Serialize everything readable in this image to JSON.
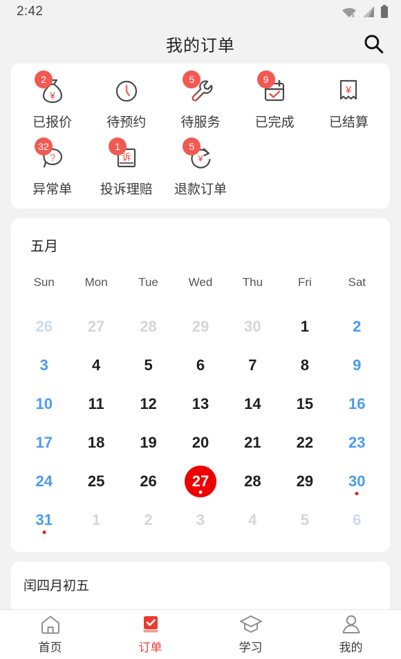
{
  "statusbar": {
    "time": "2:42",
    "icons": [
      "wifi-off-icon",
      "cellular-signal-icon",
      "battery-icon"
    ]
  },
  "header": {
    "title": "我的订单",
    "search_icon": "search-icon"
  },
  "order_status": {
    "row1": [
      {
        "icon": "money-bag-icon",
        "label": "已报价",
        "badge": "2"
      },
      {
        "icon": "clock-icon",
        "label": "待预约",
        "badge": ""
      },
      {
        "icon": "wrench-icon",
        "label": "待服务",
        "badge": "5"
      },
      {
        "icon": "calendar-check-icon",
        "label": "已完成",
        "badge": "9"
      },
      {
        "icon": "receipt-yuan-icon",
        "label": "已结算",
        "badge": ""
      }
    ],
    "row2": [
      {
        "icon": "question-bubble-icon",
        "label": "异常单",
        "badge": "32"
      },
      {
        "icon": "complaint-book-icon",
        "label": "投诉理赔",
        "badge": "1"
      },
      {
        "icon": "refund-yuan-icon",
        "label": "退款订单",
        "badge": "5"
      }
    ]
  },
  "calendar": {
    "month_label": "五月",
    "weekdays": [
      "Sun",
      "Mon",
      "Tue",
      "Wed",
      "Thu",
      "Fri",
      "Sat"
    ],
    "weeks": [
      [
        {
          "n": "26",
          "muted": true,
          "weekend": true
        },
        {
          "n": "27",
          "muted": true
        },
        {
          "n": "28",
          "muted": true
        },
        {
          "n": "29",
          "muted": true
        },
        {
          "n": "30",
          "muted": true
        },
        {
          "n": "1"
        },
        {
          "n": "2",
          "weekend": true
        }
      ],
      [
        {
          "n": "3",
          "weekend": true
        },
        {
          "n": "4"
        },
        {
          "n": "5"
        },
        {
          "n": "6"
        },
        {
          "n": "7"
        },
        {
          "n": "8"
        },
        {
          "n": "9",
          "weekend": true
        }
      ],
      [
        {
          "n": "10",
          "weekend": true
        },
        {
          "n": "11"
        },
        {
          "n": "12"
        },
        {
          "n": "13"
        },
        {
          "n": "14"
        },
        {
          "n": "15"
        },
        {
          "n": "16",
          "weekend": true
        }
      ],
      [
        {
          "n": "17",
          "weekend": true
        },
        {
          "n": "18"
        },
        {
          "n": "19"
        },
        {
          "n": "20"
        },
        {
          "n": "21"
        },
        {
          "n": "22"
        },
        {
          "n": "23",
          "weekend": true
        }
      ],
      [
        {
          "n": "24",
          "weekend": true
        },
        {
          "n": "25"
        },
        {
          "n": "26"
        },
        {
          "n": "27",
          "selected": true,
          "dot": true
        },
        {
          "n": "28"
        },
        {
          "n": "29"
        },
        {
          "n": "30",
          "weekend": true,
          "dot": true
        }
      ],
      [
        {
          "n": "31",
          "weekend": true,
          "dot": true
        },
        {
          "n": "1",
          "muted": true
        },
        {
          "n": "2",
          "muted": true
        },
        {
          "n": "3",
          "muted": true
        },
        {
          "n": "4",
          "muted": true
        },
        {
          "n": "5",
          "muted": true
        },
        {
          "n": "6",
          "muted": true,
          "weekend": true
        }
      ]
    ],
    "selected_day": "27",
    "accent_color": "#ee0000",
    "weekend_color": "#4a9bef"
  },
  "lunar": {
    "text": "闰四月初五"
  },
  "tabbar": {
    "active_color": "#ee3b30",
    "items": [
      {
        "icon": "home-icon",
        "label": "首页",
        "active": false
      },
      {
        "icon": "order-check-icon",
        "label": "订单",
        "active": true
      },
      {
        "icon": "graduation-cap-icon",
        "label": "学习",
        "active": false
      },
      {
        "icon": "person-icon",
        "label": "我的",
        "active": false
      }
    ]
  }
}
